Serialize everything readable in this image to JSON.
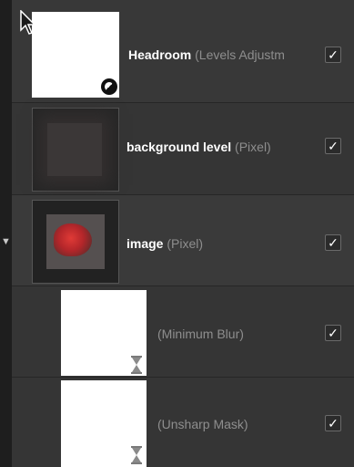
{
  "layers": [
    {
      "name": "Headroom",
      "type": "(Levels Adjustm",
      "checked": "✓",
      "icon": "adjustment-icon"
    },
    {
      "name": "background level",
      "type": "(Pixel)",
      "checked": "✓"
    },
    {
      "name": "image",
      "type": "(Pixel)",
      "checked": "✓",
      "expander": "▼"
    },
    {
      "name": "",
      "type": "(Minimum Blur)",
      "checked": "✓",
      "icon": "hourglass-icon"
    },
    {
      "name": "",
      "type": "(Unsharp Mask)",
      "checked": "✓",
      "icon": "hourglass-icon"
    }
  ],
  "colors": {
    "panel": "#353535",
    "accent_red": "#c0282b",
    "checkbox_border": "#6a6a6a"
  }
}
